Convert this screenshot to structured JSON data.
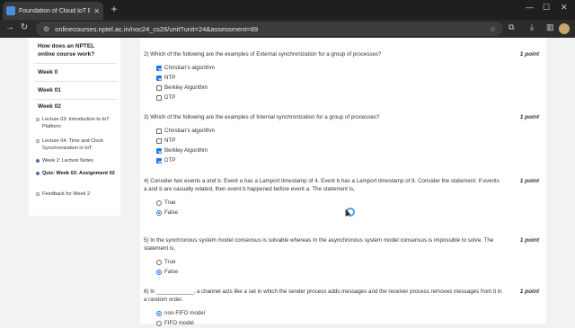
{
  "browser": {
    "tab_title": "Foundation of Cloud IoT Edge M",
    "url": "onlinecourses.nptel.ac.in/noc24_cs26/unit?unit=24&assessment=89"
  },
  "sidebar": {
    "how_label": "How does an NPTEL online course work?",
    "week0": "Week 0",
    "week1": "Week 01",
    "week2": "Week 02",
    "items": [
      {
        "label": "Lecture 03: Introduction to IoT Platform",
        "filled": false,
        "bold": false
      },
      {
        "label": "Lecture 04: Time and Clock Synchronization in IoT",
        "filled": false,
        "bold": false
      },
      {
        "label": "Week 2: Lecture Notes",
        "filled": true,
        "bold": false
      },
      {
        "label": "Quiz: Week 02: Assignment 02",
        "filled": true,
        "bold": true
      },
      {
        "label": "Feedback for Week 2",
        "filled": false,
        "bold": false
      }
    ]
  },
  "questions": [
    {
      "text": "2)   Which of the following are the examples of External synchronization for a group of processes?",
      "points": "1 point",
      "type": "checkbox",
      "options": [
        {
          "label": "Christian's algorithm",
          "checked": true
        },
        {
          "label": "NTP",
          "checked": true
        },
        {
          "label": "Berkley Algorithm",
          "checked": false
        },
        {
          "label": "DTP",
          "checked": false
        }
      ]
    },
    {
      "text": "3)   Which of the following are the examples of Internal synchronization for a group of processes?",
      "points": "1 point",
      "type": "checkbox",
      "options": [
        {
          "label": "Christian's algorithm",
          "checked": false
        },
        {
          "label": "NTP",
          "checked": false
        },
        {
          "label": "Berkley Algorithm",
          "checked": true
        },
        {
          "label": "DTP",
          "checked": true
        }
      ]
    },
    {
      "text": "4)   Consider two events a and b. Event a has a Lamport timestamp of 4. Event b has a Lamport timestamp of 8. Consider the statement: If events a and b are casually related, then event b happened before event a. The statement is,",
      "points": "1 point",
      "type": "radio",
      "options": [
        {
          "label": "True",
          "checked": false
        },
        {
          "label": "False",
          "checked": true
        }
      ]
    },
    {
      "text": "5)   In the synchronous system model consensus is solvable whereas In the asynchronous system model consensus is impossible to solve. The statement is,",
      "points": "1 point",
      "type": "radio",
      "options": [
        {
          "label": "True",
          "checked": false
        },
        {
          "label": "False",
          "checked": true
        }
      ]
    },
    {
      "text": "6)   In ____________, a channel acts like a set in which the sender process adds messages and the receiver process removes messages from it in a random order.",
      "points": "1 point",
      "type": "radio",
      "options": [
        {
          "label": "non-FIFO model",
          "checked": true
        },
        {
          "label": "FIFO model",
          "checked": false
        }
      ]
    }
  ]
}
